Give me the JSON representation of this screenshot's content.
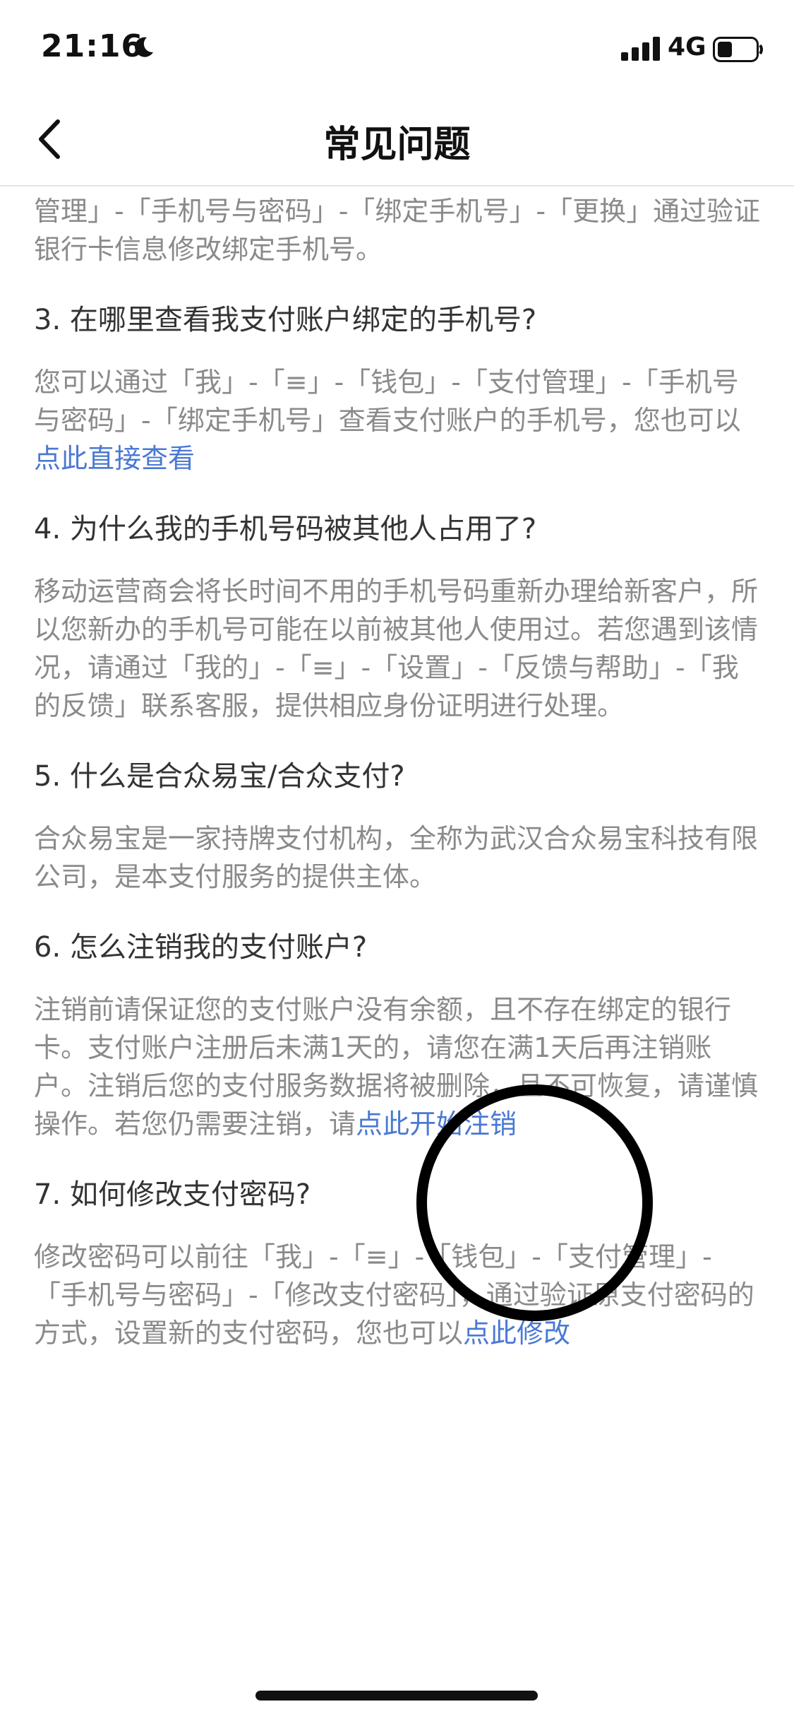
{
  "status_bar": {
    "time": "21:16",
    "network": "4G",
    "icons": [
      "moon-icon",
      "signal-icon",
      "battery-icon"
    ]
  },
  "nav": {
    "title": "常见问题",
    "back_icon": "chevron-left-icon"
  },
  "content": {
    "intro_tail": "管理」-「手机号与密码」-「绑定手机号」-「更换」通过验证银行卡信息修改绑定手机号。",
    "q3": {
      "question": "3. 在哪里查看我支付账户绑定的手机号?",
      "answer": "您可以通过「我」-「≡」-「钱包」-「支付管理」-「手机号与密码」-「绑定手机号」查看支付账户的手机号，您也可以",
      "link": "点此直接查看"
    },
    "q4": {
      "question": "4. 为什么我的手机号码被其他人占用了?",
      "answer": "移动运营商会将长时间不用的手机号码重新办理给新客户，所以您新办的手机号可能在以前被其他人使用过。若您遇到该情况，请通过「我的」-「≡」-「设置」-「反馈与帮助」-「我的反馈」联系客服，提供相应身份证明进行处理。"
    },
    "q5": {
      "question": "5. 什么是合众易宝/合众支付?",
      "answer": "合众易宝是一家持牌支付机构，全称为武汉合众易宝科技有限公司，是本支付服务的提供主体。"
    },
    "q6": {
      "question": "6. 怎么注销我的支付账户?",
      "answer": "注销前请保证您的支付账户没有余额，且不存在绑定的银行卡。支付账户注册后未满1天的，请您在满1天后再注销账户。注销后您的支付服务数据将被删除，且不可恢复，请谨慎操作。若您仍需要注销，请",
      "link": "点此开始注销"
    },
    "q7": {
      "question": "7. 如何修改支付密码?",
      "answer": "修改密码可以前往「我」-「≡」-「钱包」-「支付管理」-「手机号与密码」-「修改支付密码」，通过验证原支付密码的方式，设置新的支付密码，您也可以",
      "link": "点此修改"
    }
  },
  "colors": {
    "link": "#4a78d4",
    "answer_text": "#8a8a8a",
    "question_text": "#333333"
  }
}
